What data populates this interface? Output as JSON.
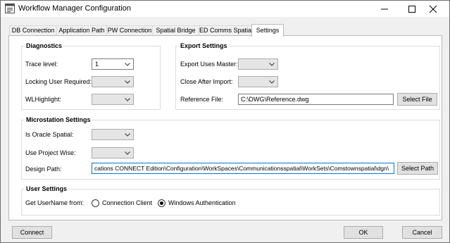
{
  "window": {
    "title": "Workflow Manager Configuration"
  },
  "tabs": [
    {
      "label": "DB Connection"
    },
    {
      "label": "Application Path"
    },
    {
      "label": "PW Connection"
    },
    {
      "label": "Spatial Bridge"
    },
    {
      "label": "ED Comms Spatial"
    },
    {
      "label": "Settings"
    }
  ],
  "active_tab": "Settings",
  "diagnostics": {
    "title": "Diagnostics",
    "trace_level": {
      "label": "Trace level:",
      "value": "1"
    },
    "locking_user_required": {
      "label": "Locking User Required:",
      "value": ""
    },
    "wl_highlight": {
      "label": "WLHighlight:",
      "value": ""
    }
  },
  "export_settings": {
    "title": "Export Settings",
    "export_uses_master": {
      "label": "Export Uses Master:",
      "value": ""
    },
    "close_after_import": {
      "label": "Close After Import:",
      "value": ""
    },
    "reference_file": {
      "label": "Reference File:",
      "value": "C:\\DWG\\Reference.dwg"
    },
    "select_file_label": "Select File"
  },
  "microstation_settings": {
    "title": "Microstation Settings",
    "is_oracle_spatial": {
      "label": "Is Oracle Spatial:",
      "value": ""
    },
    "use_project_wise": {
      "label": "Use Project Wise:",
      "value": ""
    },
    "design_path": {
      "label": "Design Path:",
      "value": "cations CONNECT Edition\\Configuration\\WorkSpaces\\Communicationsspatial\\WorkSets\\Comstownspatial\\dgn\\"
    },
    "select_path_label": "Select Path"
  },
  "user_settings": {
    "title": "User Settings",
    "get_username_label": "Get UserName from:",
    "options": [
      {
        "label": "Connection Client",
        "selected": false
      },
      {
        "label": "Windows Authentication",
        "selected": true
      }
    ]
  },
  "footer": {
    "connect_label": "Connect",
    "ok_label": "OK",
    "cancel_label": "Cancel"
  },
  "colors": {
    "focus_border": "#0078d7",
    "disabled_combo": "#e5e5e5"
  }
}
